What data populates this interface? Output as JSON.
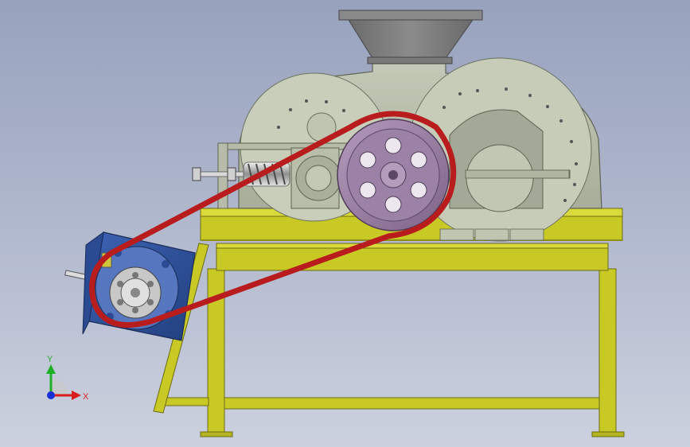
{
  "scene": {
    "description_free": true
  },
  "triad": {
    "x_label": "X",
    "y_label": "Y",
    "x_color": "#d81e1e",
    "y_color": "#1fae2a",
    "z_color": "#1b2fd6"
  },
  "colors": {
    "frame": "#c9c926",
    "frame_shadow": "#8f8f16",
    "housing": "#b5bca8",
    "hopper": "#7f7f7f",
    "belt": "#b81c1c",
    "pulley": "#9a7fa3",
    "motor": "#2e4f9c"
  }
}
